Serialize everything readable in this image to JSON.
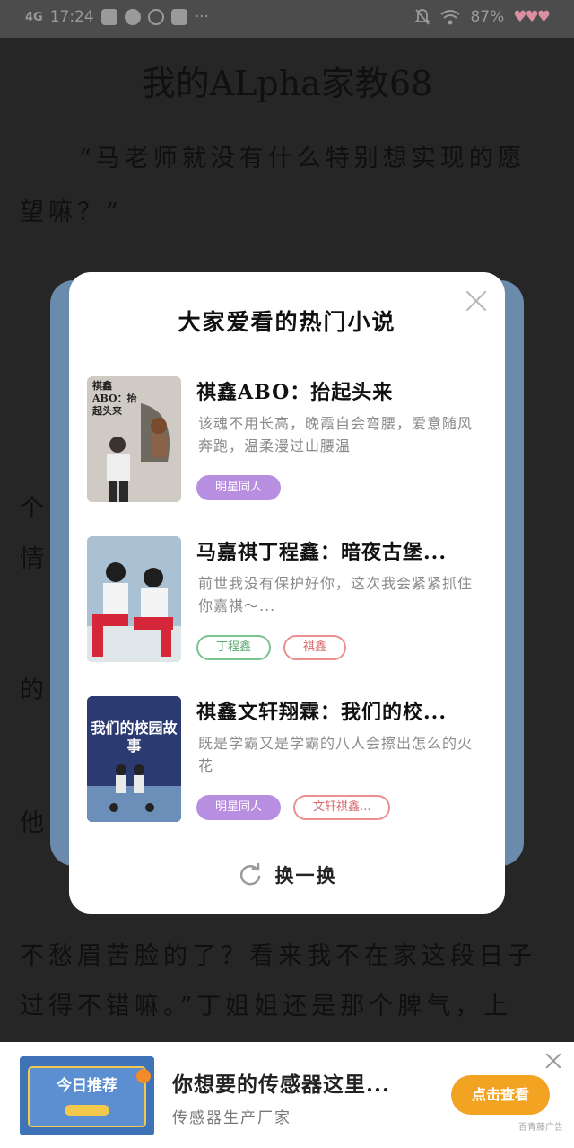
{
  "status_bar": {
    "signal": "4G",
    "time": "17:24",
    "battery": "87%",
    "icons": [
      "signal-icon",
      "photo-icon",
      "video-icon",
      "weibo-icon",
      "message-icon",
      "more-icon",
      "mute-icon",
      "wifi-icon"
    ],
    "hearts": "♥♥♥"
  },
  "reader": {
    "chapter_title": "我的ALpha家教68",
    "lines": [
      "“马老师就没有什么特别想实现的愿",
      "望嘛？”",
      "个",
      "情",
      "的",
      "他",
      "不愁眉苦脸的了？看来我不在家这段日子",
      "过得不错嘛。”丁姐姐还是那个脾气，上"
    ]
  },
  "modal": {
    "title": "大家爱看的热门小说",
    "books": [
      {
        "title": "祺鑫ABO：抬起头来",
        "desc": "该魂不用长高，晚霞自会弯腰，爱意随风奔跑，温柔漫过山腰温",
        "tags": [
          {
            "label": "明星同人",
            "style": "purple"
          }
        ],
        "cover_text": "祺鑫ABO：抬起头来"
      },
      {
        "title": "马嘉祺丁程鑫：暗夜古堡...",
        "desc": "前世我没有保护好你，这次我会紧紧抓住你嘉祺～...",
        "tags": [
          {
            "label": "丁程鑫",
            "style": "green"
          },
          {
            "label": "祺鑫",
            "style": "red"
          }
        ],
        "cover_text": ""
      },
      {
        "title": "祺鑫文轩翔霖：我们的校...",
        "desc": "既是学霸又是学霸的八人会擦出怎么的火花",
        "tags": [
          {
            "label": "明星同人",
            "style": "purple"
          },
          {
            "label": "文轩祺鑫...",
            "style": "red"
          }
        ],
        "cover_text": "我们的校园故事"
      }
    ],
    "refresh_label": "换一换"
  },
  "ad": {
    "title": "你想要的传感器这里...",
    "subtitle": "传感器生产厂家",
    "button": "点击查看",
    "image_text": "今日推荐",
    "mark": "百青藤广告"
  },
  "colors": {
    "purple_tag": "#b88ee0",
    "green_tag": "#7cc48f",
    "red_tag": "#ec8f8f",
    "ad_button": "#f3a322",
    "back_card": "#6a8bab"
  }
}
